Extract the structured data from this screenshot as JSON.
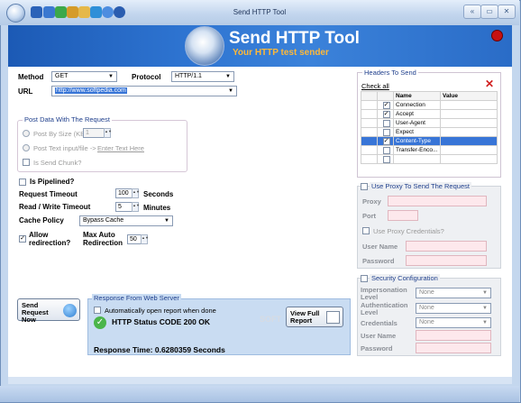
{
  "window": {
    "title": "Send HTTP Tool"
  },
  "banner": {
    "title": "Send HTTP Tool",
    "subtitle": "Your HTTP test sender"
  },
  "request": {
    "method_label": "Method",
    "method_value": "GET",
    "protocol_label": "Protocol",
    "protocol_value": "HTTP/1.1",
    "url_label": "URL",
    "url_value": "http://www.softpedia.com"
  },
  "post_data": {
    "title": "Post Data With The Request",
    "by_size_label": "Post By Size (KB)",
    "by_size_value": "1",
    "text_label": "Post Text input/file  ->",
    "text_link": "Enter Text Here",
    "chunk_label": "Is Send Chunk?"
  },
  "options": {
    "pipelined_label": "Is Pipelined?",
    "timeout_label": "Request Timeout",
    "timeout_value": "100",
    "timeout_unit": "Seconds",
    "rw_timeout_label": "Read / Write Timeout",
    "rw_timeout_value": "5",
    "rw_timeout_unit": "Minutes",
    "cache_label": "Cache Policy",
    "cache_value": "Bypass Cache",
    "redirect_label": "Allow redirection?",
    "redirect_checked": true,
    "max_redirect_label": "Max Auto Redirection",
    "max_redirect_value": "50"
  },
  "send_button": "Send Request Now",
  "response": {
    "title": "Response From Web Server",
    "auto_open_label": "Automatically open report when done",
    "status": "HTTP Status CODE 200 OK",
    "view_button": "View Full Report",
    "time": "Response Time: 0.6280359 Seconds"
  },
  "headers": {
    "title": "Headers To Send",
    "check_all": "Check all",
    "col_name": "Name",
    "col_value": "Value",
    "rows": [
      {
        "name": "Connection",
        "checked": true,
        "selected": false
      },
      {
        "name": "Accept",
        "checked": true,
        "selected": false
      },
      {
        "name": "User-Agent",
        "checked": false,
        "selected": false
      },
      {
        "name": "Expect",
        "checked": false,
        "selected": false
      },
      {
        "name": "Content-Type",
        "checked": true,
        "selected": true
      },
      {
        "name": "Transfer-Enco...",
        "checked": false,
        "selected": false
      },
      {
        "name": "",
        "checked": false,
        "selected": false
      }
    ]
  },
  "proxy": {
    "title": "Use Proxy To Send The Request",
    "proxy_label": "Proxy",
    "port_label": "Port",
    "credentials_label": "Use Proxy Credentials?",
    "user_label": "User Name",
    "password_label": "Password"
  },
  "security": {
    "title": "Security Configuration",
    "impersonation_label": "Impersonation Level",
    "impersonation_value": "None",
    "authentication_label": "Authentication Level",
    "authentication_value": "None",
    "credentials_label": "Credentials",
    "credentials_value": "None",
    "user_label": "User Name",
    "password_label": "Password"
  },
  "colors": {
    "accent": "#2e74d1",
    "subtitle": "#ffb938",
    "panel": "#c9dcf2"
  }
}
